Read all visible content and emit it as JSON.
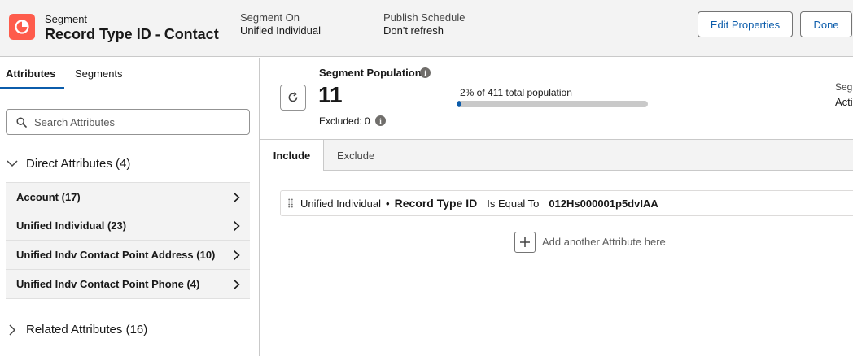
{
  "header": {
    "type_label": "Segment",
    "title": "Record Type ID - Contact",
    "segment_on_label": "Segment On",
    "segment_on_value": "Unified Individual",
    "publish_label": "Publish Schedule",
    "publish_value": "Don't refresh",
    "edit_button": "Edit Properties",
    "done_button": "Done",
    "icon": "segment-pie-icon"
  },
  "left_panel": {
    "tabs": [
      {
        "label": "Attributes",
        "active": true
      },
      {
        "label": "Segments",
        "active": false
      }
    ],
    "search_placeholder": "Search Attributes",
    "direct_section": "Direct Attributes (4)",
    "direct_items": [
      {
        "label": "Account (17)"
      },
      {
        "label": "Unified Individual (23)"
      },
      {
        "label": "Unified Indv Contact Point Address (10)"
      },
      {
        "label": "Unified Indv Contact Point Phone (4)"
      }
    ],
    "related_section": "Related Attributes (16)"
  },
  "population": {
    "title": "Segment Population",
    "count": "11",
    "excluded": "Excluded: 0",
    "percent_text": "2% of 411 total population",
    "percent_value": 2,
    "right_label_cut": "Segm",
    "right_value_cut": "Acti"
  },
  "filter_tabs": {
    "include": "Include",
    "exclude": "Exclude"
  },
  "criteria": {
    "object": "Unified Individual",
    "separator": "•",
    "field": "Record Type ID",
    "operator": "Is Equal To",
    "value": "012Hs000001p5dvIAA"
  },
  "add_attribute": "Add another Attribute here",
  "colors": {
    "brand_icon": "#fe5c4c",
    "accent": "#0b5cab",
    "panel_bg": "#f3f3f3"
  }
}
